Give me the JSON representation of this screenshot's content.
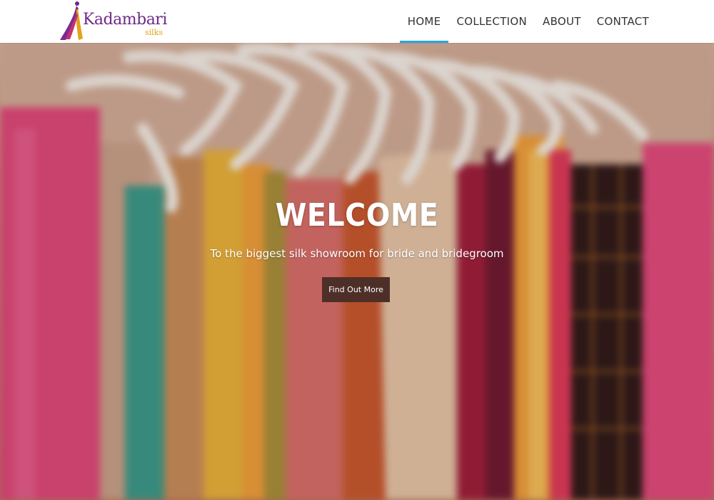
{
  "brand": {
    "name": "Kadambari",
    "sub": "silks"
  },
  "nav": {
    "items": [
      {
        "label": "HOME",
        "active": true
      },
      {
        "label": "COLLECTION",
        "active": false
      },
      {
        "label": "ABOUT",
        "active": false
      },
      {
        "label": "CONTACT",
        "active": false
      }
    ],
    "active_color": "#28a5d8"
  },
  "hero": {
    "title": "WELCOME",
    "subtitle": "To the biggest silk showroom for bride and bridegroom",
    "button_label": "Find Out More",
    "button_color": "#4e2f28"
  }
}
